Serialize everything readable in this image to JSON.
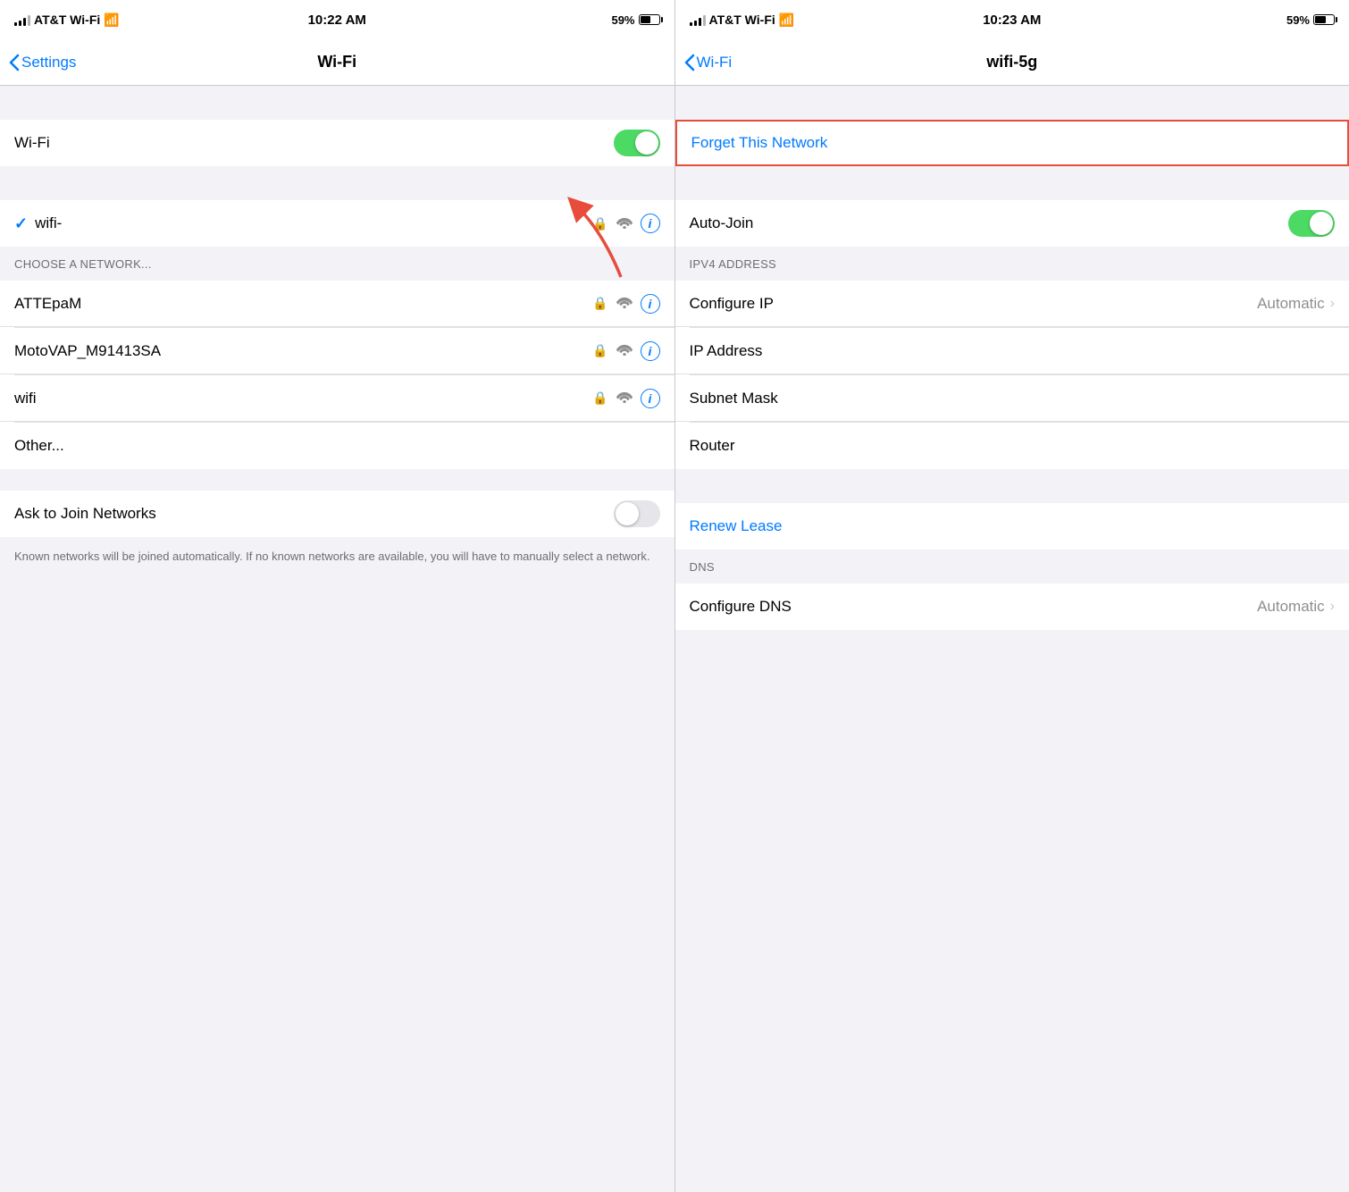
{
  "left_panel": {
    "status_bar": {
      "carrier": "AT&T Wi-Fi",
      "time": "10:22 AM",
      "battery_percent": "59%"
    },
    "nav": {
      "back_label": "Settings",
      "title": "Wi-Fi"
    },
    "wifi_row": {
      "label": "Wi-Fi"
    },
    "connected_network": {
      "name": "wifi-"
    },
    "choose_section": {
      "header": "CHOOSE A NETWORK..."
    },
    "networks": [
      {
        "name": "ATTEpaM"
      },
      {
        "name": "MotoVAP_M91413SA"
      },
      {
        "name": "wifi"
      },
      {
        "name": "Other..."
      }
    ],
    "ask_join": {
      "label": "Ask to Join Networks"
    },
    "footer_text": "Known networks will be joined automatically. If no known networks are available, you will have to manually select a network."
  },
  "right_panel": {
    "status_bar": {
      "carrier": "AT&T Wi-Fi",
      "time": "10:23 AM",
      "battery_percent": "59%"
    },
    "nav": {
      "back_label": "Wi-Fi",
      "title": "wifi-5g"
    },
    "forget_label": "Forget This Network",
    "auto_join_label": "Auto-Join",
    "ipv4_section": {
      "header": "IPV4 ADDRESS"
    },
    "ip_rows": [
      {
        "label": "Configure IP",
        "value": "Automatic"
      },
      {
        "label": "IP Address",
        "value": ""
      },
      {
        "label": "Subnet Mask",
        "value": ""
      },
      {
        "label": "Router",
        "value": ""
      }
    ],
    "renew_lease_label": "Renew Lease",
    "dns_section": {
      "header": "DNS"
    },
    "dns_rows": [
      {
        "label": "Configure DNS",
        "value": "Automatic"
      }
    ]
  }
}
